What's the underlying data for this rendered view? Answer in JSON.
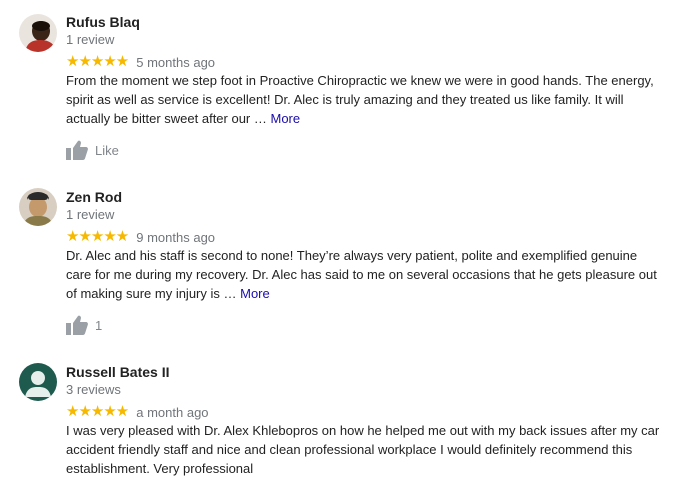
{
  "reviews": [
    {
      "author": "Rufus Blaq",
      "review_count": "1 review",
      "stars": "★★★★★",
      "rating": 5,
      "date": "5 months ago",
      "text": "From the moment we step foot in Proactive Chiropractic we knew we were in good hands. The energy, spirit as well as service is excellent! Dr. Alec is truly amazing and they treated us like family. It will actually be bitter sweet after our … ",
      "more_label": "More",
      "like_label": "Like",
      "avatar_icon": "person-photo-icon"
    },
    {
      "author": "Zen Rod",
      "review_count": "1 review",
      "stars": "★★★★★",
      "rating": 5,
      "date": "9 months ago",
      "text": "Dr. Alec and his staff is second to none! They’re always very patient, polite and exemplified genuine care for me during my recovery. Dr. Alec has said to me on several occasions that he gets pleasure out of making sure my injury is … ",
      "more_label": "More",
      "like_label": "1",
      "avatar_icon": "person-photo-icon"
    },
    {
      "author": "Russell Bates II",
      "review_count": "3 reviews",
      "stars": "★★★★★",
      "rating": 5,
      "date": "a month ago",
      "text": "I was very pleased with Dr. Alex Khlebopros on how he helped me out with my back issues after my car accident friendly staff and nice and clean professional workplace I would definitely recommend this establishment. Very professional",
      "avatar_icon": "default-person-icon",
      "avatar_color": "#1e5a4e"
    }
  ],
  "colors": {
    "star": "#f6b900",
    "more_link": "#1a0dab",
    "secondary_text": "#70757a"
  }
}
